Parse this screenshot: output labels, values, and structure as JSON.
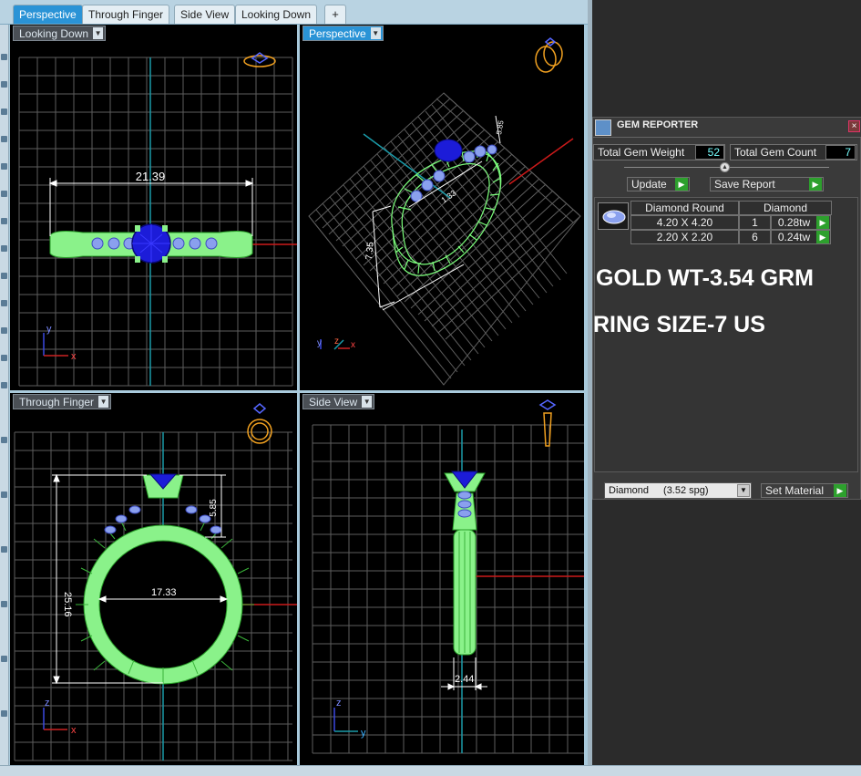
{
  "tabs": [
    {
      "label": "Perspective",
      "active": true
    },
    {
      "label": "Through Finger",
      "active": false
    },
    {
      "label": "Side View",
      "active": false
    },
    {
      "label": "Looking Down",
      "active": false
    }
  ],
  "tab_add_label": "+",
  "viewports": {
    "top_left": {
      "label": "Looking Down",
      "dimension": "21.39",
      "axis_a": "y",
      "axis_b": "x"
    },
    "top_right": {
      "label": "Perspective",
      "dim_a": "7.35",
      "dim_b": "1.33",
      "dim_c": "5.85",
      "axis_a": "y",
      "axis_b": "z",
      "axis_c": "x"
    },
    "bottom_left": {
      "label": "Through Finger",
      "dim_height": "25.16",
      "dim_width": "17.33",
      "dim_head": "5.85",
      "axis_a": "z",
      "axis_b": "x"
    },
    "bottom_right": {
      "label": "Side View",
      "dim_width": "2.44",
      "axis_a": "z",
      "axis_b": "y"
    }
  },
  "gem_reporter": {
    "title": "GEM REPORTER",
    "close_label": "×",
    "total_weight_label": "Total Gem Weight",
    "total_weight_value": "52",
    "total_count_label": "Total Gem Count",
    "total_count_value": "7",
    "update_label": "Update",
    "save_report_label": "Save Report",
    "go_glyph": "▶",
    "table": {
      "col1": "Diamond Round",
      "col2": "Diamond",
      "rows": [
        {
          "size": "4.20 X 4.20",
          "count": "1",
          "tw": "0.28tw"
        },
        {
          "size": "2.20 X 2.20",
          "count": "6",
          "tw": "0.24tw"
        }
      ]
    },
    "material_name": "Diamond",
    "material_spg": "(3.52 spg)",
    "set_material_label": "Set Material"
  },
  "overlay": {
    "gold_weight": "GOLD WT-3.54 GRM",
    "ring_size": "RING SIZE-7 US"
  },
  "colors": {
    "ring": "#7dff7d",
    "gem": "#1a1acc",
    "grid": "#6a6a6a",
    "accent": "#2a93d6"
  }
}
